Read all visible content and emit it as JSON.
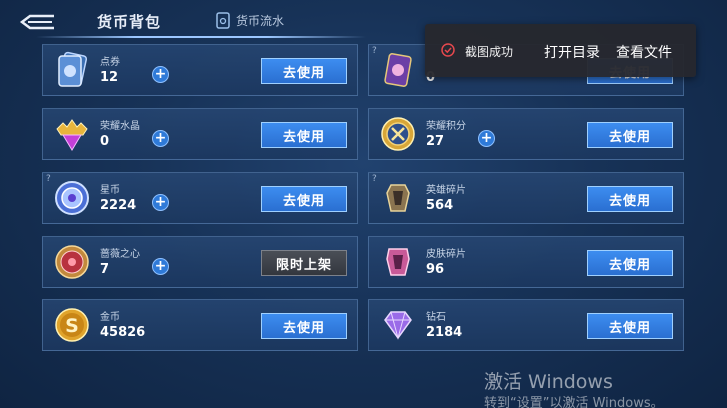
{
  "header": {
    "title": "货币背包",
    "flow_tab": "货币流水"
  },
  "cards": [
    {
      "name": "点券",
      "count": "12",
      "button": "去使用",
      "icon": "ticket-icon"
    },
    {
      "name": "",
      "count": "0",
      "button": "去使用",
      "icon": "purple-card-icon"
    },
    {
      "name": "荣耀水晶",
      "count": "0",
      "button": "去使用",
      "icon": "crystal-icon"
    },
    {
      "name": "荣耀积分",
      "count": "27",
      "button": "去使用",
      "icon": "points-coin-icon"
    },
    {
      "name": "星币",
      "count": "2224",
      "button": "去使用",
      "icon": "star-coin-icon"
    },
    {
      "name": "英雄碎片",
      "count": "564",
      "button": "去使用",
      "icon": "hero-shard-icon"
    },
    {
      "name": "蔷薇之心",
      "count": "7",
      "button": "限时上架",
      "icon": "rose-heart-icon"
    },
    {
      "name": "皮肤碎片",
      "count": "96",
      "button": "去使用",
      "icon": "skin-shard-icon"
    },
    {
      "name": "金币",
      "count": "45826",
      "button": "去使用",
      "icon": "gold-coin-icon"
    },
    {
      "name": "钻石",
      "count": "2184",
      "button": "去使用",
      "icon": "diamond-icon"
    }
  ],
  "toast": {
    "message": "截图成功",
    "open_dir": "打开目录",
    "view_file": "查看文件"
  },
  "watermark": {
    "line1": "激活 Windows",
    "line2": "转到“设置”以激活 Windows。"
  },
  "colors": {
    "accent": "#2f7ad8",
    "button": "#3d8df0",
    "card_bg": "#264672",
    "toast_bg": "#26282e",
    "success": "#e5484d"
  }
}
